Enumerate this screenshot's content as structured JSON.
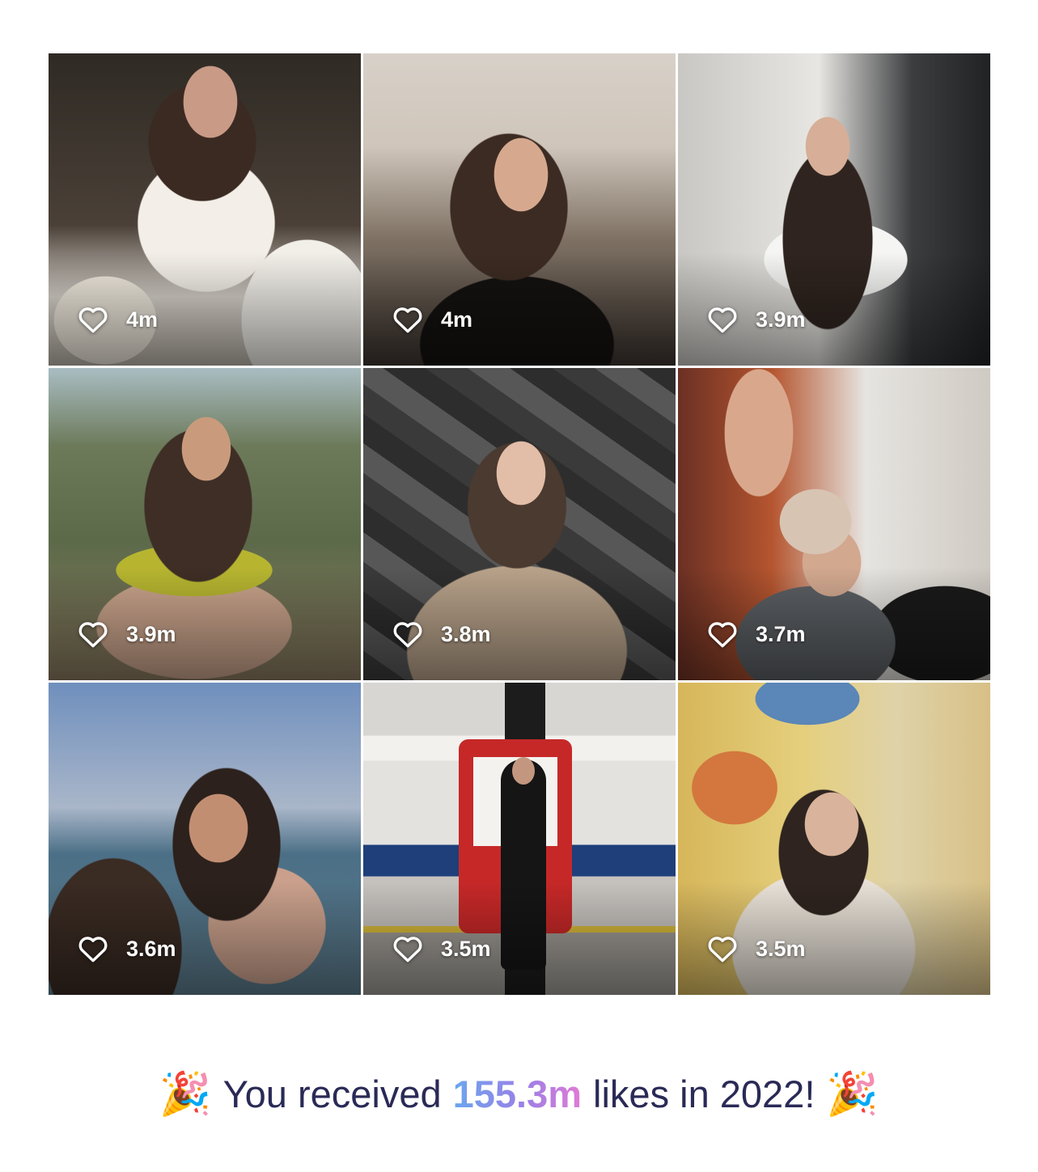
{
  "posts": [
    {
      "likes": "4m"
    },
    {
      "likes": "4m"
    },
    {
      "likes": "3.9m"
    },
    {
      "likes": "3.9m"
    },
    {
      "likes": "3.8m"
    },
    {
      "likes": "3.7m"
    },
    {
      "likes": "3.6m"
    },
    {
      "likes": "3.5m"
    },
    {
      "likes": "3.5m"
    }
  ],
  "icons": {
    "likes": "heart-outline-icon",
    "celebration": "party-popper-icon"
  },
  "summary": {
    "emoji_left": "🎉",
    "prefix": "You received",
    "total": "155.3m",
    "suffix": "likes in 2022!",
    "emoji_right": "🎉"
  },
  "colors": {
    "text": "#2a2a57",
    "highlight_gradient": [
      "#6aa6ee",
      "#9b7fe6",
      "#e07bd6"
    ],
    "like_overlay": "#ffffff"
  }
}
